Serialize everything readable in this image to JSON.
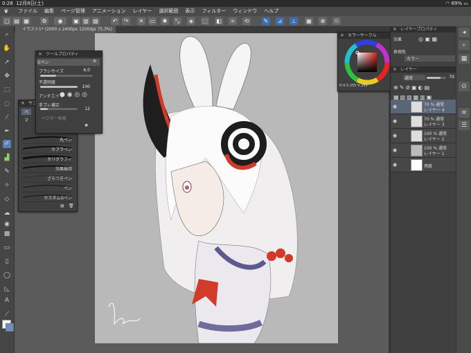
{
  "status": {
    "time": "0:28",
    "date": "12月8日(土)",
    "battery": "69%"
  },
  "menu": [
    "ファイル",
    "編集",
    "ページ管理",
    "アニメーション",
    "レイヤー",
    "選択範囲",
    "表示",
    "フィルター",
    "ウィンドウ",
    "ヘルプ"
  ],
  "canvas_tab": "イラスト1* (2000 x 2400px 1200dpi 75.3%)",
  "tool_property": {
    "title": "ツールプロパティ",
    "subtool": "Gペン",
    "brush_size_label": "ブラシサイズ",
    "brush_size": "6.0",
    "opacity_label": "不透明度",
    "opacity": "100",
    "antialias_label": "アンチエイリ",
    "stabilization_label": "手ブレ補正",
    "stabilization": "12",
    "vector_label": "ベクター吸着"
  },
  "subtool_panel": {
    "title": "サブツール",
    "tabs": [
      "ペ",
      "マ"
    ],
    "brushes": [
      "丸ペン",
      "カブラペン",
      "カリグラフィ",
      "効果線用",
      "ざらつきペン",
      "ペン",
      "カスタムGペン"
    ]
  },
  "color_wheel": {
    "title": "カラーサークル",
    "h": "H",
    "s": "S",
    "v": "V",
    "h_val": "0",
    "s_val": "255",
    "v_val": "255"
  },
  "layer_property": {
    "title": "レイヤープロパティ",
    "effect_label": "効果",
    "color_label": "表現色",
    "color_value": "カラー"
  },
  "layer_panel": {
    "title": "レイヤー",
    "blend_mode": "通常",
    "opacity": "70",
    "layers": [
      {
        "mode": "70 % 通常",
        "name": "レイヤー 4",
        "selected": true
      },
      {
        "mode": "70 % 通常",
        "name": "レイヤー 3",
        "selected": false
      },
      {
        "mode": "100 % 通常",
        "name": "レイヤー 2",
        "selected": false
      },
      {
        "mode": "100 % 通常",
        "name": "レイヤー 1",
        "selected": false
      },
      {
        "mode": "",
        "name": "用紙",
        "selected": false
      }
    ]
  }
}
